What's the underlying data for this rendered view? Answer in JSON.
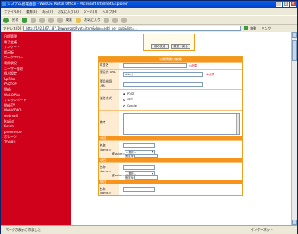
{
  "window": {
    "title": "システム管理画面 - WebOS Portal Office - Microsoft Internet Explorer"
  },
  "menu": [
    "ファイル(F)",
    "編集(E)",
    "表示(V)",
    "お気に入り(A)",
    "ツール(T)",
    "ヘルプ(H)"
  ],
  "toolbar": {
    "back": "戻る",
    "search": "検索",
    "favorites": "お気に入り"
  },
  "address": {
    "label": "アドレス(D)",
    "url": "http://192.167.187.1/wwwroot/?yat=item&dop=add_per_pub&list=...",
    "go": "移動",
    "links": "リンク"
  },
  "sidebar": [
    "日程管理",
    "電子会議",
    "アンケート",
    "掲示板",
    "ワークフロー",
    "利用状況",
    "ユーザー管理",
    "個人設定",
    "UpFiles",
    "FAQTOP",
    "Web",
    "WebOffice",
    "ナレッジボード",
    "WebTV",
    "WebVIDEO",
    "webmail",
    "Mailist",
    "forum",
    "preference",
    "ボレーン",
    "TOORU"
  ],
  "topbox": {
    "btn1": "前の設定",
    "btn2": "変更・戻る"
  },
  "form": {
    "header": "公開情報の編集",
    "title_label": "文書名",
    "title_req": "※必須",
    "url_label": "運用先 URL",
    "url_value": "http://",
    "url_req": "※必須",
    "ref_url_label": "運用参照 URL",
    "method_label": "送信方式",
    "methods": [
      "POST",
      "GET",
      "Cookie"
    ],
    "note_label": "備考",
    "param_section": "項目",
    "name_label": "名称 Name=",
    "value_label": "値Value=",
    "select_placeholder": "--選択--",
    "fixed_label": "固定値"
  },
  "status": {
    "left": "ページが表示されました",
    "zone": "インターネット"
  }
}
